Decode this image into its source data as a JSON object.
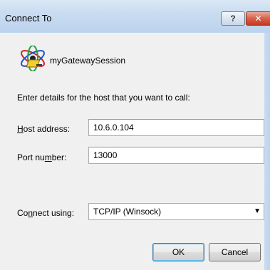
{
  "window": {
    "title": "Connect To"
  },
  "session": {
    "name": "myGatewaySession",
    "icon": "session-atom-icon"
  },
  "instructions": "Enter details for the host that you want to call:",
  "host": {
    "label_pre": "",
    "label_key": "H",
    "label_post": "ost address:",
    "value": "10.6.0.104"
  },
  "port": {
    "label_pre": "Port nu",
    "label_key": "m",
    "label_post": "ber:",
    "value": "13000"
  },
  "connect": {
    "label_pre": "Co",
    "label_key": "n",
    "label_post": "nect using:",
    "value": "TCP/IP (Winsock)"
  },
  "buttons": {
    "ok": "OK",
    "cancel": "Cancel"
  },
  "titlebar": {
    "help_symbol": "?",
    "close_symbol": "✕"
  }
}
